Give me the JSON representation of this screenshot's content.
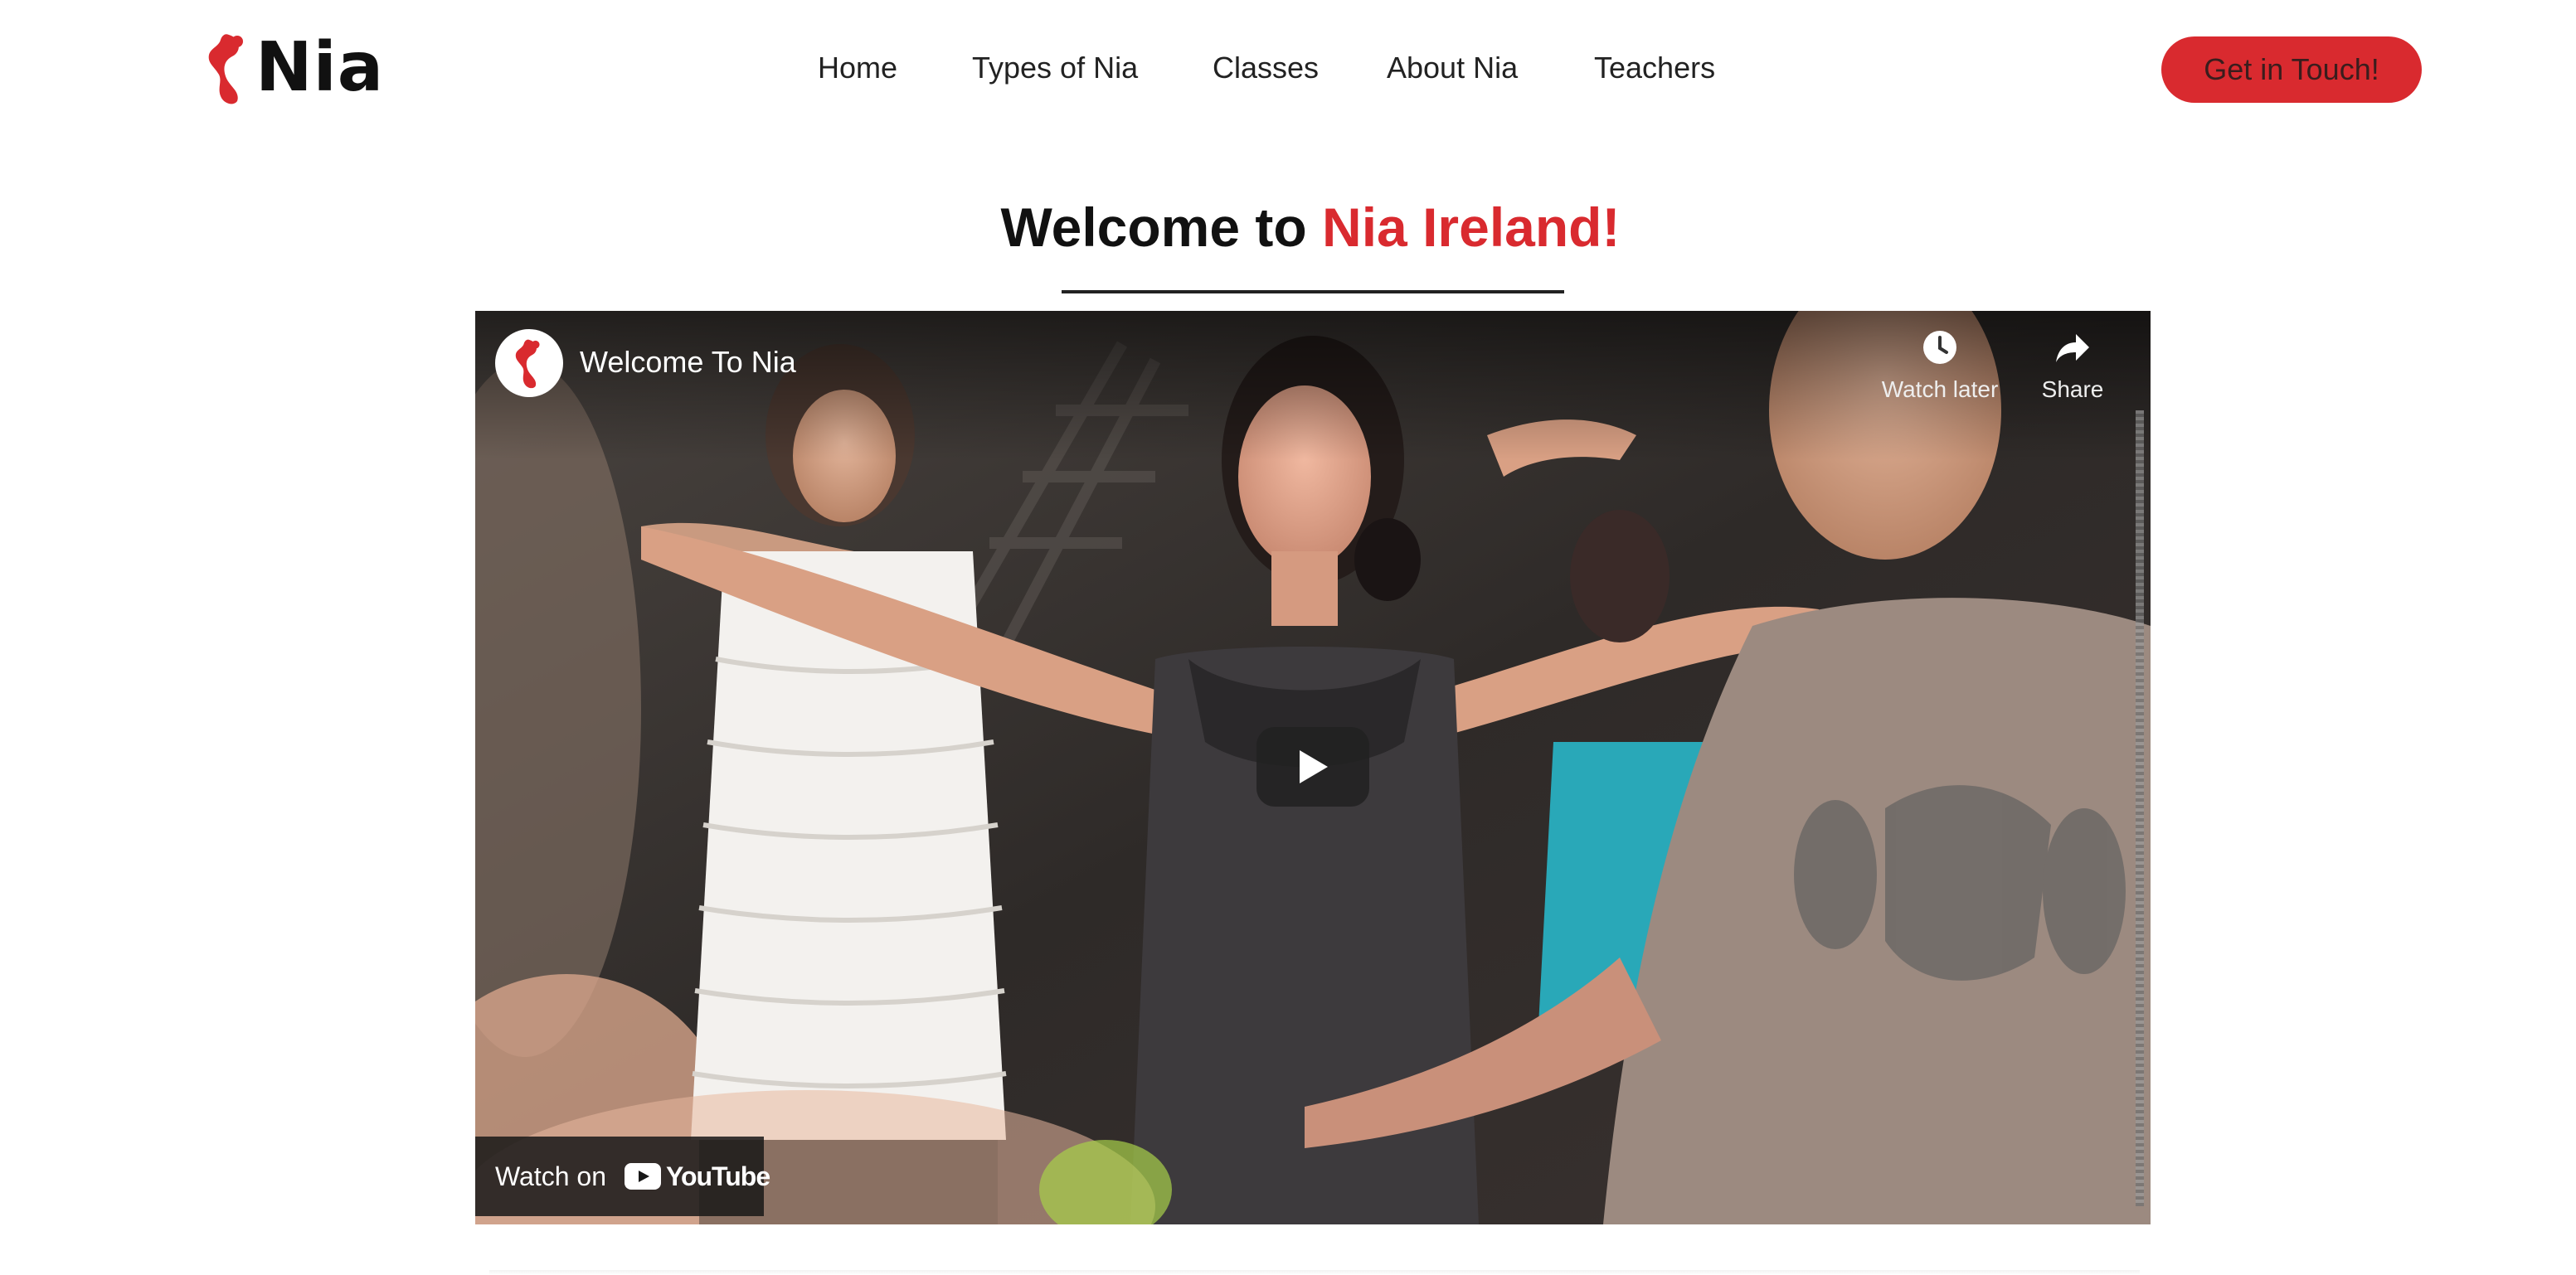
{
  "brand": {
    "name": "Nia",
    "accent_color": "#d92a2f",
    "logo_icon": "nia-figure-icon"
  },
  "nav": {
    "items": [
      {
        "label": "Home"
      },
      {
        "label": "Types of Nia"
      },
      {
        "label": "Classes"
      },
      {
        "label": "About Nia"
      },
      {
        "label": "Teachers"
      }
    ],
    "cta_label": "Get in Touch!"
  },
  "heading": {
    "prefix": "Welcome to ",
    "highlight": "Nia Ireland!"
  },
  "video": {
    "title": "Welcome To Nia",
    "channel_icon": "nia-figure-icon",
    "watch_later_label": "Watch later",
    "share_label": "Share",
    "watch_on_label": "Watch on",
    "youtube_wordmark": "YouTube"
  }
}
